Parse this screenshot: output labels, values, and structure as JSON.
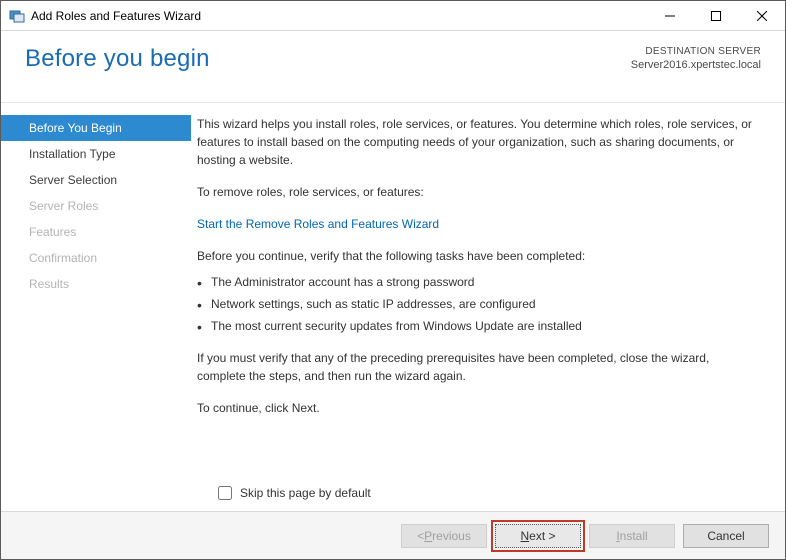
{
  "window": {
    "title": "Add Roles and Features Wizard"
  },
  "header": {
    "headline": "Before you begin",
    "destination_label": "DESTINATION SERVER",
    "destination_value": "Server2016.xpertstec.local"
  },
  "sidebar": {
    "items": [
      {
        "label": "Before You Begin",
        "state": "active"
      },
      {
        "label": "Installation Type",
        "state": "normal"
      },
      {
        "label": "Server Selection",
        "state": "normal"
      },
      {
        "label": "Server Roles",
        "state": "disabled"
      },
      {
        "label": "Features",
        "state": "disabled"
      },
      {
        "label": "Confirmation",
        "state": "disabled"
      },
      {
        "label": "Results",
        "state": "disabled"
      }
    ]
  },
  "content": {
    "intro": "This wizard helps you install roles, role services, or features. You determine which roles, role services, or features to install based on the computing needs of your organization, such as sharing documents, or hosting a website.",
    "remove_label": "To remove roles, role services, or features:",
    "remove_link": "Start the Remove Roles and Features Wizard",
    "verify_intro": "Before you continue, verify that the following tasks have been completed:",
    "bullets": [
      "The Administrator account has a strong password",
      "Network settings, such as static IP addresses, are configured",
      "The most current security updates from Windows Update are installed"
    ],
    "must_verify": "If you must verify that any of the preceding prerequisites have been completed, close the wizard, complete the steps, and then run the wizard again.",
    "continue": "To continue, click Next.",
    "skip_label": "Skip this page by default"
  },
  "footer": {
    "previous_pre": "< ",
    "previous_u": "P",
    "previous_post": "revious",
    "next_u": "N",
    "next_post": "ext >",
    "install_u": "I",
    "install_post": "nstall",
    "cancel": "Cancel"
  }
}
